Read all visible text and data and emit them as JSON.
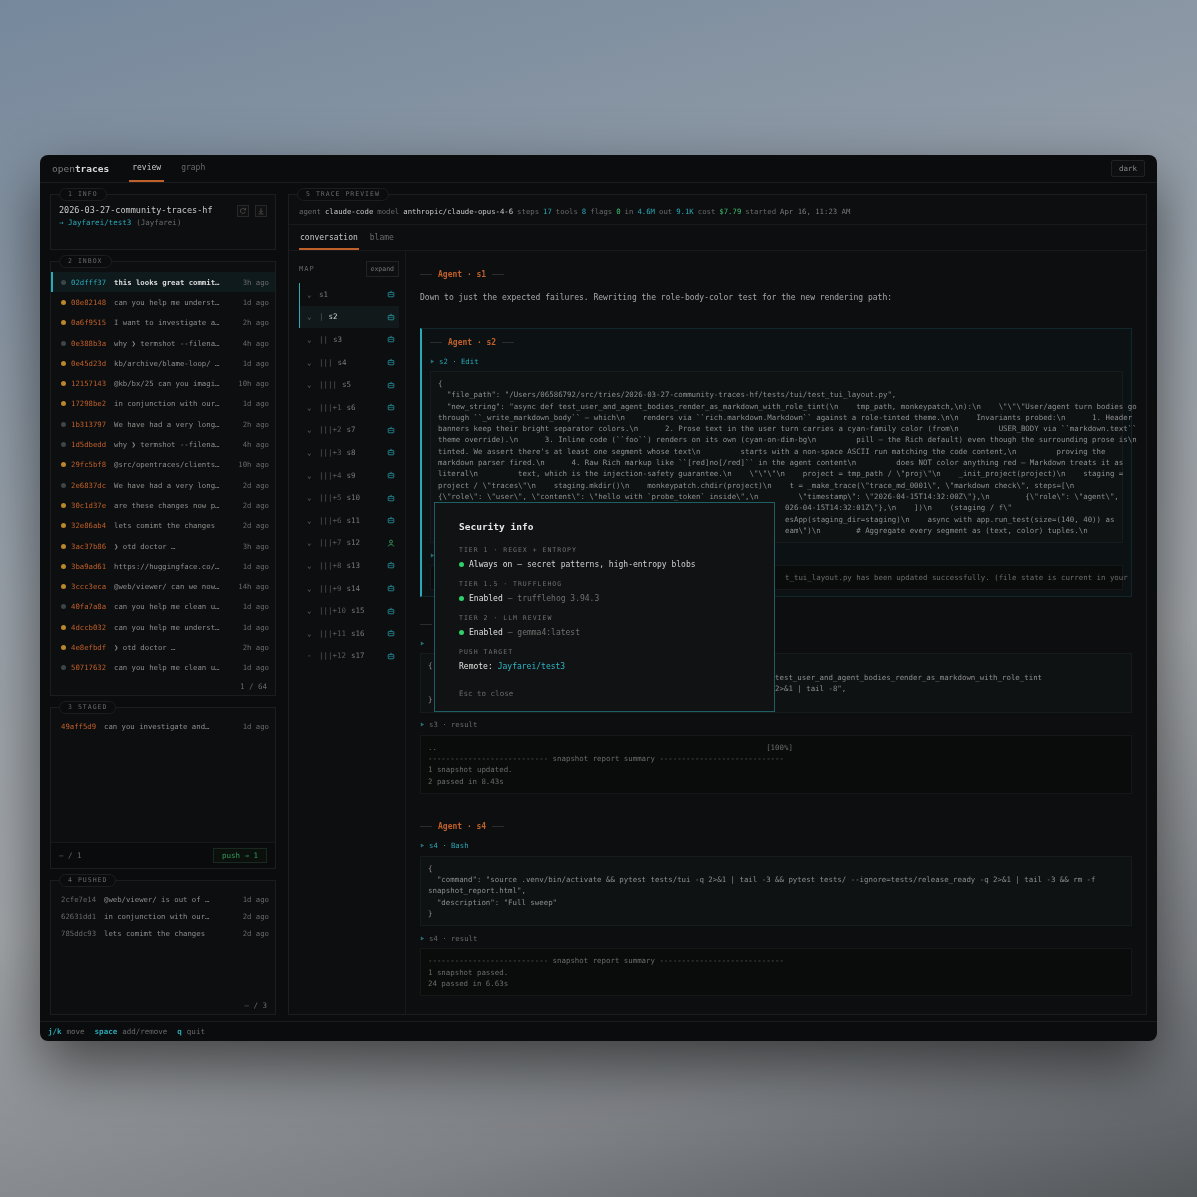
{
  "topbar": {
    "logo_light": "open",
    "logo_bold": "traces",
    "tabs": [
      {
        "label": "review",
        "selected": true
      },
      {
        "label": "graph",
        "selected": false
      }
    ],
    "theme_button": "dark"
  },
  "info": {
    "key": "1",
    "label": "INFO",
    "title": "2026-03-27-community-traces-hf",
    "remote": "→ Jayfarei/test3",
    "owner": "(Jayfarei)"
  },
  "inbox": {
    "key": "2",
    "label": "INBOX",
    "footer": "1 / 64",
    "rows": [
      {
        "hash": "02dfff37",
        "message": "this looks great commit…",
        "age": "3h ago",
        "color": "#3d4549",
        "selected": true
      },
      {
        "hash": "08e82148",
        "message": "can you help me underst…",
        "age": "1d ago",
        "color": "#b8862b",
        "selected": false
      },
      {
        "hash": "0a6f9515",
        "message": "I want to investigate a…",
        "age": "2h ago",
        "color": "#b8862b",
        "selected": false
      },
      {
        "hash": "0e388b3a",
        "message": "why ❯ termshot --filena…",
        "age": "4h ago",
        "color": "#3d4549",
        "selected": false
      },
      {
        "hash": "0e45d23d",
        "message": "kb/archive/blame-loop/ …",
        "age": "1d ago",
        "color": "#b8862b",
        "selected": false
      },
      {
        "hash": "12157143",
        "message": "@kb/bx/25 can you imagi…",
        "age": "10h ago",
        "color": "#b8862b",
        "selected": false
      },
      {
        "hash": "17298be2",
        "message": "in conjunction with our…",
        "age": "1d ago",
        "color": "#b8862b",
        "selected": false
      },
      {
        "hash": "1b313797",
        "message": "We have had a very long…",
        "age": "2h ago",
        "color": "#3d4549",
        "selected": false
      },
      {
        "hash": "1d5dbedd",
        "message": "why ❯ termshot --filena…",
        "age": "4h ago",
        "color": "#3d4549",
        "selected": false
      },
      {
        "hash": "29fc5bf8",
        "message": "@src/opentraces/clients…",
        "age": "10h ago",
        "color": "#b8862b",
        "selected": false
      },
      {
        "hash": "2e6837dc",
        "message": "We have had a very long…",
        "age": "2d ago",
        "color": "#3d4549",
        "selected": false
      },
      {
        "hash": "30c1d37e",
        "message": "are these changes now p…",
        "age": "2d ago",
        "color": "#b8862b",
        "selected": false
      },
      {
        "hash": "32e86ab4",
        "message": "lets comimt the changes",
        "age": "2d ago",
        "color": "#b8862b",
        "selected": false
      },
      {
        "hash": "3ac37b86",
        "message": "❯ otd doctor …",
        "age": "3h ago",
        "color": "#b8862b",
        "selected": false
      },
      {
        "hash": "3ba9ad61",
        "message": "https://huggingface.co/…",
        "age": "1d ago",
        "color": "#b8862b",
        "selected": false
      },
      {
        "hash": "3ccc3eca",
        "message": "@web/viewer/ can we now…",
        "age": "14h ago",
        "color": "#b8862b",
        "selected": false
      },
      {
        "hash": "40fa7a8a",
        "message": "can you help me clean u…",
        "age": "1d ago",
        "color": "#3d4549",
        "selected": false
      },
      {
        "hash": "4dccb032",
        "message": "can you help me underst…",
        "age": "1d ago",
        "color": "#b8862b",
        "selected": false
      },
      {
        "hash": "4e8efbdf",
        "message": "❯ otd doctor …",
        "age": "2h ago",
        "color": "#b8862b",
        "selected": false
      },
      {
        "hash": "50717632",
        "message": "can you help me clean u…",
        "age": "1d ago",
        "color": "#3d4549",
        "selected": false
      }
    ]
  },
  "staged": {
    "key": "3",
    "label": "STAGED",
    "position": "– / 1",
    "push_button": "push → 1",
    "rows": [
      {
        "hash": "49aff5d9",
        "message": "can you investigate and…",
        "age": "1d ago"
      }
    ]
  },
  "pushed": {
    "key": "4",
    "label": "PUSHED",
    "position": "– / 3",
    "rows": [
      {
        "hash": "2cfe7e14",
        "message": "@web/viewer/ is out of …",
        "age": "1d ago"
      },
      {
        "hash": "62631dd1",
        "message": "in conjunction with our…",
        "age": "2d ago"
      },
      {
        "hash": "785ddc93",
        "message": "lets comimt the changes",
        "age": "2d ago"
      }
    ]
  },
  "preview": {
    "key": "5",
    "label": "TRACE PREVIEW",
    "meta": [
      {
        "label": "agent",
        "value": "claude-code",
        "kind": "name"
      },
      {
        "label": "model",
        "value": "anthropic/claude-opus-4-6",
        "kind": "name"
      },
      {
        "label": "steps",
        "value": "17",
        "kind": "count"
      },
      {
        "label": "tools",
        "value": "8",
        "kind": "count"
      },
      {
        "label": "flags",
        "value": "0",
        "kind": "good"
      },
      {
        "label": "in",
        "value": "4.6M",
        "kind": "count"
      },
      {
        "label": "out",
        "value": "9.1K",
        "kind": "count"
      },
      {
        "label": "cost",
        "value": "$7.79",
        "kind": "good"
      },
      {
        "label": "started",
        "value": "Apr 16, 11:23 AM",
        "kind": "date"
      }
    ],
    "tabs": [
      {
        "label": "conversation",
        "selected": true
      },
      {
        "label": "blame",
        "selected": false
      }
    ],
    "map": {
      "label": "MAP",
      "expand_button": "expand",
      "items": [
        {
          "toggle": "⌄",
          "step": "s1",
          "kind": "agent",
          "in_view": true,
          "selected": false
        },
        {
          "toggle": "⌄",
          "prefix": "|",
          "step": "s2",
          "kind": "agent",
          "in_view": true,
          "selected": true
        },
        {
          "toggle": "⌄",
          "prefix": "||",
          "step": "s3",
          "kind": "agent",
          "in_view": false,
          "selected": false
        },
        {
          "toggle": "⌄",
          "prefix": "|||",
          "step": "s4",
          "kind": "agent",
          "in_view": false,
          "selected": false
        },
        {
          "toggle": "⌄",
          "prefix": "||||",
          "step": "s5",
          "kind": "agent",
          "in_view": false,
          "selected": false
        },
        {
          "toggle": "⌄",
          "prefix": "|||+1",
          "step": "s6",
          "kind": "agent",
          "in_view": false,
          "selected": false
        },
        {
          "toggle": "⌄",
          "prefix": "|||+2",
          "step": "s7",
          "kind": "agent",
          "in_view": false,
          "selected": false
        },
        {
          "toggle": "⌄",
          "prefix": "|||+3",
          "step": "s8",
          "kind": "agent",
          "in_view": false,
          "selected": false
        },
        {
          "toggle": "⌄",
          "prefix": "|||+4",
          "step": "s9",
          "kind": "agent",
          "in_view": false,
          "selected": false
        },
        {
          "toggle": "⌄",
          "prefix": "|||+5",
          "step": "s10",
          "kind": "agent",
          "in_view": false,
          "selected": false
        },
        {
          "toggle": "⌄",
          "prefix": "|||+6",
          "step": "s11",
          "kind": "agent",
          "in_view": false,
          "selected": false
        },
        {
          "toggle": "⌄",
          "prefix": "|||+7",
          "step": "s12",
          "kind": "user",
          "in_view": false,
          "selected": false
        },
        {
          "toggle": "⌄",
          "prefix": "|||+8",
          "step": "s13",
          "kind": "agent",
          "in_view": false,
          "selected": false
        },
        {
          "toggle": "⌄",
          "prefix": "|||+9",
          "step": "s14",
          "kind": "agent",
          "in_view": false,
          "selected": false
        },
        {
          "toggle": "⌄",
          "prefix": "|||+10",
          "step": "s15",
          "kind": "agent",
          "in_view": false,
          "selected": false
        },
        {
          "toggle": "⌄",
          "prefix": "|||+11",
          "step": "s16",
          "kind": "agent",
          "in_view": false,
          "selected": false
        },
        {
          "toggle": "-",
          "prefix": "|||+12",
          "step": "s17",
          "kind": "agent",
          "in_view": false,
          "selected": false
        }
      ]
    },
    "conversation": [
      {
        "header": "Agent · s1",
        "selected": false,
        "text": "Down to just the expected failures. Rewriting the role-body-color test for the new rendering path:"
      },
      {
        "header": "Agent · s2",
        "selected": true,
        "tool": "s2 · Edit",
        "code": [
          {
            "text": "{"
          },
          {
            "text": "  \"file_path\": \"/Users/06586792/src/tries/2026-03-27-community-traces-hf/tests/tui/test_tui_layout.py\","
          },
          {
            "text": "  \"new_string\": \"async def test_user_and_agent_bodies_render_as_markdown_with_role_tint(\\n    tmp_path, monkeypatch,\\n):\\n    \\\"\\\"\\\"User/agent turn bodies go"
          },
          {
            "text": "through ``_write_markdown_body`` — which\\n    renders via ``rich.markdown.Markdown`` against a role-tinted theme.\\n\\n    Invariants probed:\\n      1. Header"
          },
          {
            "text": "banners keep their bright separator colors.\\n      2. Prose text in the user turn carries a cyan-family color (from\\n         USER_BODY via ``markdown.text``"
          },
          {
            "text": "theme override).\\n      3. Inline code (``foo``) renders on its own (cyan-on-dim-bg\\n         pill — the Rich default) even though the surrounding prose is\\n"
          },
          {
            "text": "tinted. We assert there's at least one segment whose text\\n         starts with a non-space ASCII run matching the code content,\\n         proving the"
          },
          {
            "text": "markdown parser fired.\\n      4. Raw Rich markup like ``[red]no[/red]`` in the agent content\\n         does NOT color anything red — Markdown treats it as"
          },
          {
            "text": "literal\\n         text, which is the injection-safety guarantee.\\n    \\\"\\\"\\\"\\n    project = tmp_path / \\\"proj\\\"\\n    _init_project(project)\\n    staging ="
          },
          {
            "text": "project / \\\"traces\\\"\\n    staging.mkdir()\\n    monkeypatch.chdir(project)\\n    t = _make_trace(\\\"trace_md_0001\\\", \\\"markdown check\\\", steps=[\\n"
          },
          {
            "text": "{\\\"role\\\": \\\"user\\\", \\\"content\\\": \\\"hello with `probe_token` inside\\\",\\n         \\\"timestamp\\\": \\\"2026-04-15T14:32:00Z\\\"},\\n        {\\\"role\\\": \\\"agent\\\","
          },
          {
            "text": "026-04-15T14:32:01Z\\\"},\\n    ])\\n    (staging / f\\\"",
            "tail": true
          },
          {
            "text": "esApp(staging_dir=staging)\\n    async with app.run_test(size=(140, 40)) as",
            "tail": true
          },
          {
            "text": "eam\\\")\\n        # Aggregate every segment as (text, color) tuples.\\n",
            "tail": true
          }
        ],
        "result": [
          {
            "text": "t_tui_layout.py has been updated successfully. (file state is current in your",
            "tail": true
          }
        ]
      },
      {
        "selected": false,
        "code": [
          {
            "text": "{"
          },
          {
            "text": "test_user_and_agent_bodies_render_as_markdown_with_role_tint",
            "tail": true
          },
          {
            "text": "2>&1 | tail -8\",",
            "tail": true
          },
          {
            "text": "}"
          }
        ],
        "result_label": "s3 · result",
        "result": [
          {
            "text": "..                                                                          [100%]"
          },
          {
            "text": "--------------------------- snapshot report summary ----------------------------"
          },
          {
            "text": "1 snapshot updated."
          },
          {
            "text": "2 passed in 8.43s"
          }
        ]
      },
      {
        "header": "Agent · s4",
        "selected": false,
        "tool": "s4 · Bash",
        "code": [
          {
            "text": "{"
          },
          {
            "text": "  \"command\": \"source .venv/bin/activate && pytest tests/tui -q 2>&1 | tail -3 && pytest tests/ --ignore=tests/release_ready -q 2>&1 | tail -3 && rm -f"
          },
          {
            "text": "snapshot_report.html\","
          },
          {
            "text": "  \"description\": \"Full sweep\""
          },
          {
            "text": "}"
          }
        ],
        "result_label": "s4 · result",
        "result": [
          {
            "text": "--------------------------- snapshot report summary ----------------------------"
          },
          {
            "text": "1 snapshot passed."
          },
          {
            "text": "24 passed in 6.63s"
          }
        ]
      }
    ]
  },
  "hints": [
    {
      "key": "j/k",
      "action": "move"
    },
    {
      "key": "space",
      "action": "add/remove"
    },
    {
      "key": "q",
      "action": "quit"
    }
  ],
  "modal": {
    "title": "Security info",
    "tiers": [
      {
        "heading": "TIER 1 · REGEX + ENTROPY",
        "active": true,
        "status": "Always on",
        "detail": "— secret patterns, high-entropy blobs",
        "muted": false
      },
      {
        "heading": "TIER 1.5 · TRUFFLEHOG",
        "active": true,
        "status": "Enabled",
        "detail": "— trufflehog 3.94.3",
        "muted": true
      },
      {
        "heading": "TIER 2 · LLM REVIEW",
        "active": true,
        "status": "Enabled",
        "detail": "— gemma4:latest",
        "muted": true
      }
    ],
    "push_heading": "PUSH TARGET",
    "push_label": "Remote:",
    "push_value": "Jayfarei/test3",
    "footer": "Esc to close"
  }
}
